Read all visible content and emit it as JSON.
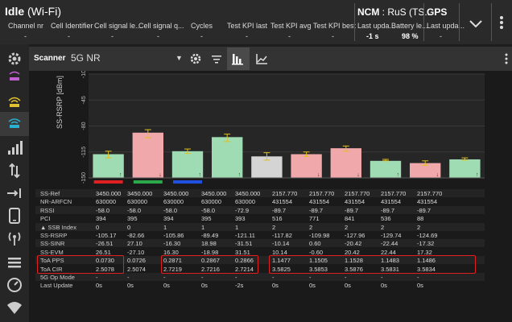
{
  "header": {
    "title": "Idle",
    "title_sub": "(Wi-Fi)",
    "columns": [
      {
        "label": "Channel nr",
        "value": "-"
      },
      {
        "label": "Cell Identifier",
        "value": "-"
      },
      {
        "label": "Cell signal le...",
        "value": "-"
      },
      {
        "label": "Cell signal q...",
        "value": "-"
      },
      {
        "label": "Cycles",
        "value": "-"
      },
      {
        "label": "Test KPI last",
        "value": "-"
      },
      {
        "label": "Test KPI avg",
        "value": "-"
      },
      {
        "label": "Test KPI best",
        "value": "-"
      }
    ],
    "ncm": {
      "title": "NCM",
      "title_sub": ": RuS (TS...",
      "last_update_label": "Last upda...",
      "last_update_value": "-1 s",
      "battery_label": "Battery le...",
      "battery_value": "98 %"
    },
    "gps": {
      "title": "GPS",
      "last_update_label": "Last upda...",
      "last_update_value": "-"
    }
  },
  "scanner": {
    "label": "Scanner",
    "network": "5G NR"
  },
  "chart_data": {
    "type": "bar",
    "ylabel": "SS-RSRP [dBm]",
    "yticks": [
      -10,
      -45,
      -80,
      -115,
      -150
    ],
    "ylim": [
      -150,
      -10
    ],
    "values": [
      -118,
      -89,
      -114,
      -95,
      -121,
      -118,
      -110,
      -127,
      -130,
      -125
    ],
    "error_low": [
      -123,
      -96,
      -117,
      -101,
      -126,
      -121,
      -114,
      -127,
      -133,
      -126
    ],
    "error_high": [
      -114,
      -85,
      -111,
      -91,
      -116,
      -115,
      -107,
      -125,
      -127,
      -123
    ],
    "bar_colors": [
      "#9fdcb4",
      "#f0a8aa",
      "#9fdcb4",
      "#9fdcb4",
      "#d4d4d4",
      "#f0a8aa",
      "#f0a8aa",
      "#9fdcb4",
      "#f0a8aa",
      "#9fdcb4"
    ],
    "arrows": [
      "↑",
      "↓",
      "↑",
      "↑",
      "",
      "↓",
      "↓",
      "↑",
      "↓",
      "↑"
    ],
    "markers": [
      {
        "index": 0,
        "color": "#e02020"
      },
      {
        "index": 1,
        "color": "#2aa84a"
      },
      {
        "index": 2,
        "color": "#2050e0"
      }
    ]
  },
  "table": {
    "rows": [
      {
        "label": "SS-Ref",
        "values": [
          "3450.000",
          "3450.000",
          "3450.000",
          "3450.000",
          "3450.000",
          "2157.770",
          "2157.770",
          "2157.770",
          "2157.770",
          "2157.770"
        ]
      },
      {
        "label": "NR-ARFCN",
        "values": [
          "630000",
          "630000",
          "630000",
          "630000",
          "630000",
          "431554",
          "431554",
          "431554",
          "431554",
          "431554"
        ]
      },
      {
        "label": "RSSI",
        "values": [
          "-58.0",
          "-58.0",
          "-58.0",
          "-58.0",
          "-72.9",
          "-89.7",
          "-89.7",
          "-89.7",
          "-89.7",
          "-89.7"
        ]
      },
      {
        "label": "PCI",
        "values": [
          "394",
          "395",
          "394",
          "395",
          "393",
          "516",
          "771",
          "841",
          "536",
          "88"
        ]
      },
      {
        "label": "▲ SSB Index",
        "values": [
          "0",
          "0",
          "1",
          "1",
          "1",
          "2",
          "2",
          "2",
          "2",
          "2"
        ]
      },
      {
        "label": "SS-RSRP",
        "values": [
          "-105.17",
          "-82.66",
          "-105.86",
          "-89.49",
          "-121.11",
          "-117.82",
          "-109.98",
          "-127.96",
          "-129.74",
          "-124.69"
        ]
      },
      {
        "label": "SS-SINR",
        "values": [
          "-26.51",
          "27.10",
          "-16.30",
          "18.98",
          "-31.51",
          "-10.14",
          "0.60",
          "-20.42",
          "-22.44",
          "-17.32"
        ]
      },
      {
        "label": "SS-EVM",
        "values": [
          "26.51",
          "-27.10",
          "16.30",
          "-18.98",
          "31.51",
          "10.14",
          "-0.60",
          "20.42",
          "22.44",
          "17.32"
        ]
      },
      {
        "label": "ToA PPS",
        "values": [
          "0.0730",
          "0.0726",
          "0.2871",
          "0.2867",
          "0.2866",
          "1.1477",
          "1.1505",
          "1.1528",
          "1.1483",
          "1.1486"
        ]
      },
      {
        "label": "ToA CIR",
        "values": [
          "2.5078",
          "2.5074",
          "2.7219",
          "2.7216",
          "2.7214",
          "3.5825",
          "3.5853",
          "3.5876",
          "3.5831",
          "3.5834"
        ]
      },
      {
        "label": "5G Op Mode",
        "values": [
          "-",
          "-",
          "-",
          "-",
          "-",
          "-",
          "-",
          "-",
          "-",
          "-"
        ]
      },
      {
        "label": "Last Update",
        "values": [
          "0s",
          "0s",
          "0s",
          "0s",
          "-2s",
          "0s",
          "0s",
          "0s",
          "0s",
          "0s"
        ]
      }
    ]
  }
}
